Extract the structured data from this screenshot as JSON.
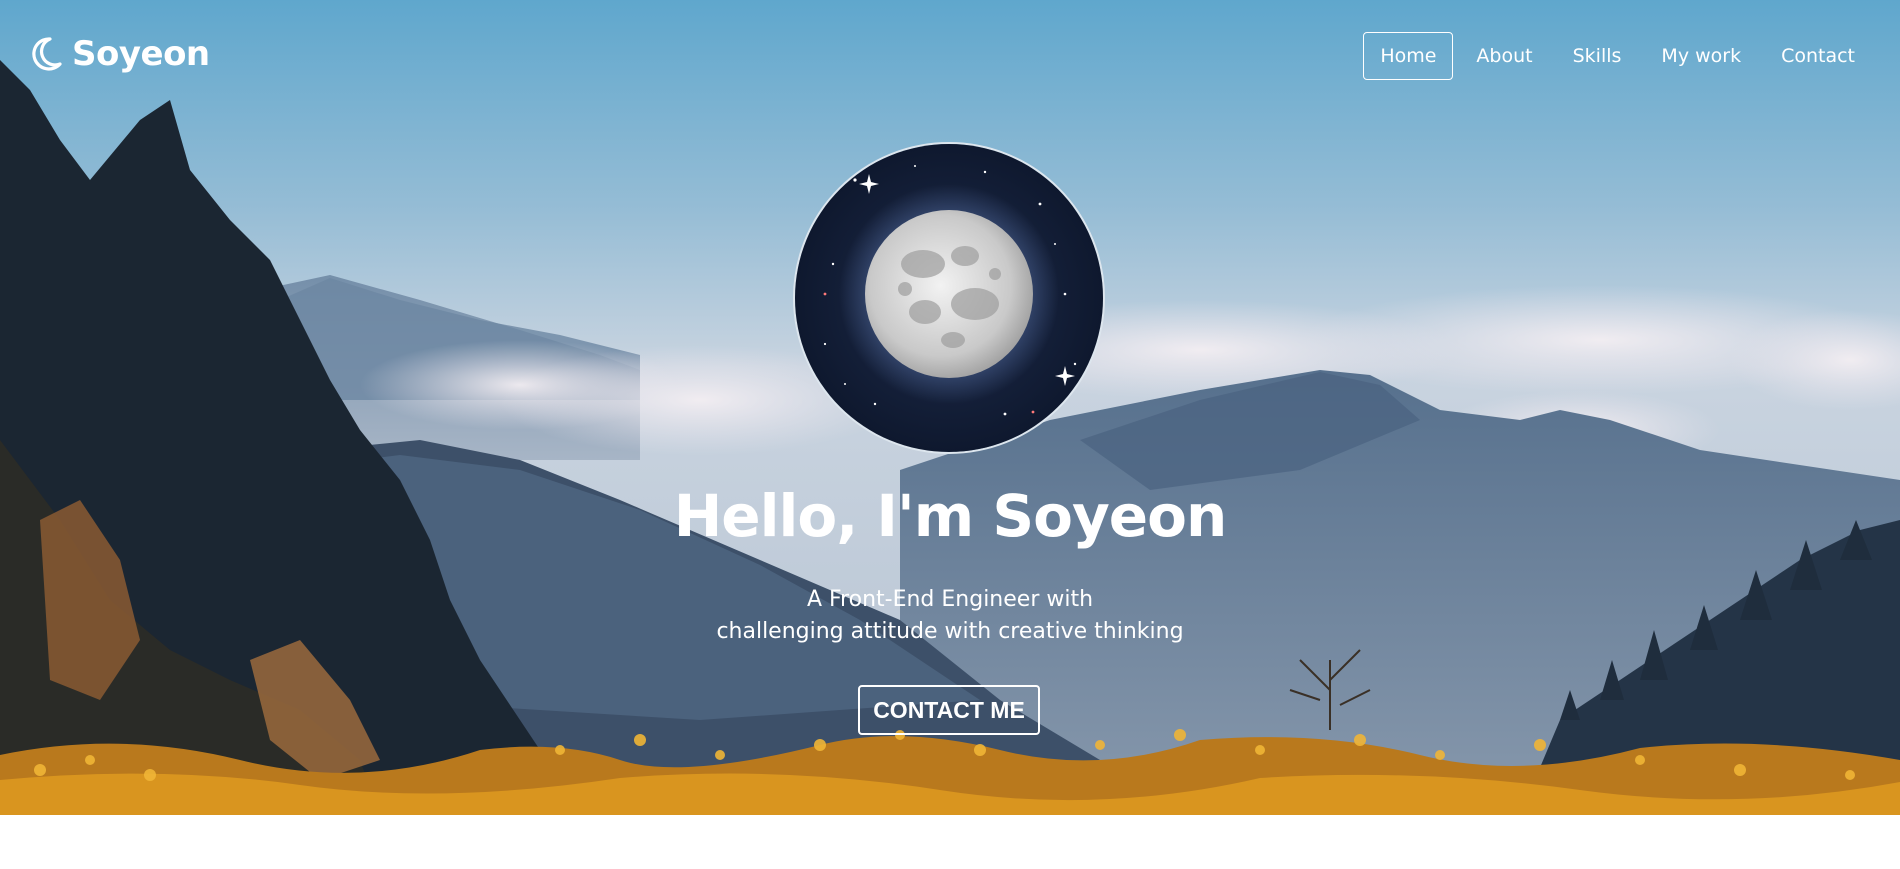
{
  "brand": {
    "name": "Soyeon",
    "icon": "moon-icon"
  },
  "nav": {
    "items": [
      {
        "label": "Home",
        "active": true
      },
      {
        "label": "About",
        "active": false
      },
      {
        "label": "Skills",
        "active": false
      },
      {
        "label": "My work",
        "active": false
      },
      {
        "label": "Contact",
        "active": false
      }
    ]
  },
  "hero": {
    "title": "Hello, I'm Soyeon",
    "description_line1": "A Front-End Engineer with",
    "description_line2": "challenging attitude with creative thinking",
    "cta_label": "CONTACT ME",
    "avatar": "full-moon-night-sky",
    "background": "mountain-landscape-with-clouds"
  },
  "colors": {
    "text": "#ffffff",
    "sky_top": "#6aaed0",
    "avatar_bg": "#0e1a33",
    "flowers": "#d9951f"
  }
}
